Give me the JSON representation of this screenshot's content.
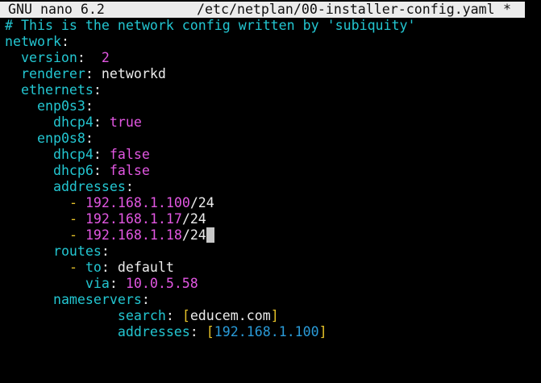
{
  "titlebar": {
    "app": "GNU nano 6.2",
    "file": "/etc/netplan/00-installer-config.yaml",
    "modified": "*"
  },
  "colors": {
    "comment": "#23c6d1",
    "key": "#23c6d1",
    "value_magenta": "#e257e2",
    "dash_yellow": "#e6c229",
    "flow_ip_blue": "#2a9bd8",
    "titlebar_bg": "#ececec",
    "background": "#000000"
  },
  "lines": {
    "comment": "# This is the network config written by 'subiquity'",
    "network_key": "network",
    "version_key": "version",
    "version_val": "2",
    "renderer_key": "renderer",
    "renderer_val": "networkd",
    "ethernets_key": "ethernets",
    "if1": "enp0s3",
    "if1_dhcp4_key": "dhcp4",
    "if1_dhcp4_val": "true",
    "if2": "enp0s8",
    "if2_dhcp4_key": "dhcp4",
    "if2_dhcp4_val": "false",
    "if2_dhcp6_key": "dhcp6",
    "if2_dhcp6_val": "false",
    "addresses_key": "addresses",
    "address_items": [
      {
        "ip": "192.168.1.100",
        "mask": "/24"
      },
      {
        "ip": "192.168.1.17",
        "mask": "/24"
      },
      {
        "ip": "192.168.1.18",
        "mask": "/24"
      }
    ],
    "routes_key": "routes",
    "to_key": "to",
    "to_val": "default",
    "via_key": "via",
    "via_val": "10.0.5.58",
    "nameservers_key": "nameservers",
    "search_key": "search",
    "search_val": "educem.com",
    "ns_addresses_key": "addresses",
    "ns_addresses_val": "192.168.1.100"
  }
}
